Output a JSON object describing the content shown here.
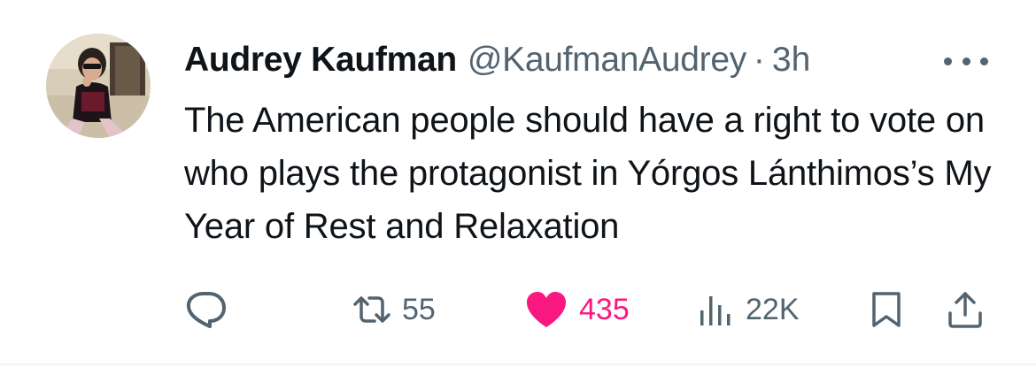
{
  "author": {
    "name": "Audrey Kaufman",
    "handle": "@KaufmanAudrey",
    "separator": "·",
    "time": "3h"
  },
  "tweet": {
    "text": "The American people should have a right to vote on who plays the protagonist in Yórgos Lánthimos’s My Year of Rest and Relaxation"
  },
  "actions": {
    "reply": {
      "icon": "reply-icon",
      "count": ""
    },
    "retweet": {
      "icon": "retweet-icon",
      "count": "55"
    },
    "like": {
      "icon": "heart-icon",
      "count": "435",
      "color": "#f91880",
      "liked": true
    },
    "views": {
      "icon": "views-icon",
      "count": "22K"
    },
    "bookmark": {
      "icon": "bookmark-icon"
    },
    "share": {
      "icon": "share-icon"
    }
  },
  "colors": {
    "text": "#0f1419",
    "secondary": "#536471",
    "like": "#f91880",
    "divider": "#eff3f4"
  }
}
